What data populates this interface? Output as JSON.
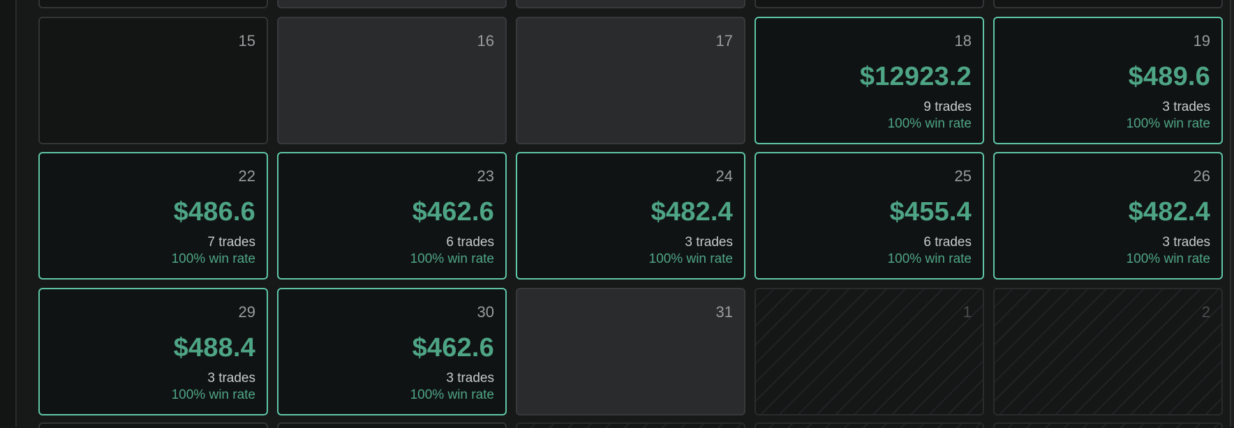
{
  "colors": {
    "profit": "#4ea586",
    "traded_border": "#5ec7a6",
    "empty_fill": "#2a2b2d",
    "background": "#171818"
  },
  "rows": [
    {
      "days": [
        {
          "day": "15",
          "state": "blank"
        },
        {
          "day": "16",
          "state": "empty"
        },
        {
          "day": "17",
          "state": "empty"
        },
        {
          "day": "18",
          "state": "traded",
          "pnl": "$12923.2",
          "trades": "9 trades",
          "winrate": "100% win rate"
        },
        {
          "day": "19",
          "state": "traded",
          "pnl": "$489.6",
          "trades": "3 trades",
          "winrate": "100% win rate"
        }
      ]
    },
    {
      "days": [
        {
          "day": "22",
          "state": "traded",
          "pnl": "$486.6",
          "trades": "7 trades",
          "winrate": "100% win rate"
        },
        {
          "day": "23",
          "state": "traded",
          "pnl": "$462.6",
          "trades": "6 trades",
          "winrate": "100% win rate"
        },
        {
          "day": "24",
          "state": "traded",
          "pnl": "$482.4",
          "trades": "3 trades",
          "winrate": "100% win rate"
        },
        {
          "day": "25",
          "state": "traded",
          "pnl": "$455.4",
          "trades": "6 trades",
          "winrate": "100% win rate"
        },
        {
          "day": "26",
          "state": "traded",
          "pnl": "$482.4",
          "trades": "3 trades",
          "winrate": "100% win rate"
        }
      ]
    },
    {
      "days": [
        {
          "day": "29",
          "state": "traded",
          "pnl": "$488.4",
          "trades": "3 trades",
          "winrate": "100% win rate"
        },
        {
          "day": "30",
          "state": "traded",
          "pnl": "$462.6",
          "trades": "3 trades",
          "winrate": "100% win rate"
        },
        {
          "day": "31",
          "state": "empty"
        },
        {
          "day": "1",
          "state": "outside"
        },
        {
          "day": "2",
          "state": "outside"
        }
      ]
    }
  ]
}
